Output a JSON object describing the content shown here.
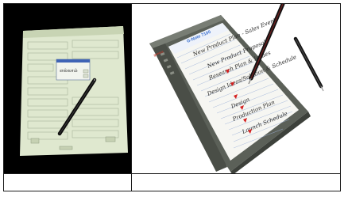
{
  "left_photo": {
    "screen_dialog_text": "எல்லாம்"
  },
  "right_photo": {
    "device_brand": "G-Note 7100",
    "device_logo": "genius",
    "handwritten_lines": [
      "New Product Plan - Sales Event",
      "New Product Proposal",
      "Research Plan & Issues",
      "Design Ideas/Solution & Schedule",
      "Design",
      "Production Plan",
      "Launch Schedule"
    ]
  },
  "colors": {
    "frame_border": "#1a1a1a",
    "screen_background": "#dfe8cf",
    "device_body": "#5b6058",
    "paper": "#f6f6f2",
    "paper_rule": "#9fb3d9",
    "arrow_red": "#d42020"
  }
}
